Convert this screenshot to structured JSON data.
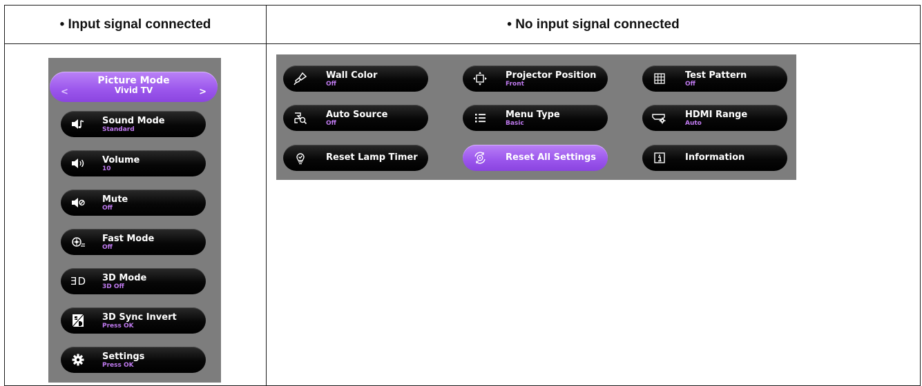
{
  "headers": {
    "left": "• Input signal connected",
    "right": "• No input signal connected"
  },
  "left_menu": {
    "picture_mode": {
      "label": "Picture Mode",
      "value": "Vivid TV",
      "prev": "<",
      "next": ">"
    },
    "items": [
      {
        "label": "Sound Mode",
        "value": "Standard",
        "icon": "speaker-note-icon"
      },
      {
        "label": "Volume",
        "value": "10",
        "icon": "speaker-volume-icon"
      },
      {
        "label": "Mute",
        "value": "Off",
        "icon": "speaker-mute-icon"
      },
      {
        "label": "Fast Mode",
        "value": "Off",
        "icon": "fast-mode-icon"
      },
      {
        "label": "3D Mode",
        "value": "3D Off",
        "icon": "3d-icon",
        "icon_text": "ƎD"
      },
      {
        "label": "3D Sync Invert",
        "value": "Press OK",
        "icon": "3d-sync-invert-icon"
      },
      {
        "label": "Settings",
        "value": "Press OK",
        "icon": "gear-icon"
      }
    ]
  },
  "right_menu": {
    "items": [
      {
        "label": "Wall Color",
        "value": "Off",
        "icon": "paint-brush-icon"
      },
      {
        "label": "Projector Position",
        "value": "Front",
        "icon": "projector-position-icon"
      },
      {
        "label": "Test Pattern",
        "value": "Off",
        "icon": "grid-icon"
      },
      {
        "label": "Auto Source",
        "value": "Off",
        "icon": "auto-source-icon"
      },
      {
        "label": "Menu Type",
        "value": "Basic",
        "icon": "list-icon"
      },
      {
        "label": "HDMI Range",
        "value": "Auto",
        "icon": "hdmi-range-icon"
      },
      {
        "label": "Reset Lamp Timer",
        "icon": "lamp-reset-icon"
      },
      {
        "label": "Reset All Settings",
        "icon": "reset-gear-icon",
        "highlighted": true
      },
      {
        "label": "Information",
        "icon": "info-icon"
      }
    ]
  },
  "colors": {
    "panel_gray": "#7d7d7d",
    "highlight_purple": "#9b56ec",
    "value_purple": "#c07af0"
  }
}
